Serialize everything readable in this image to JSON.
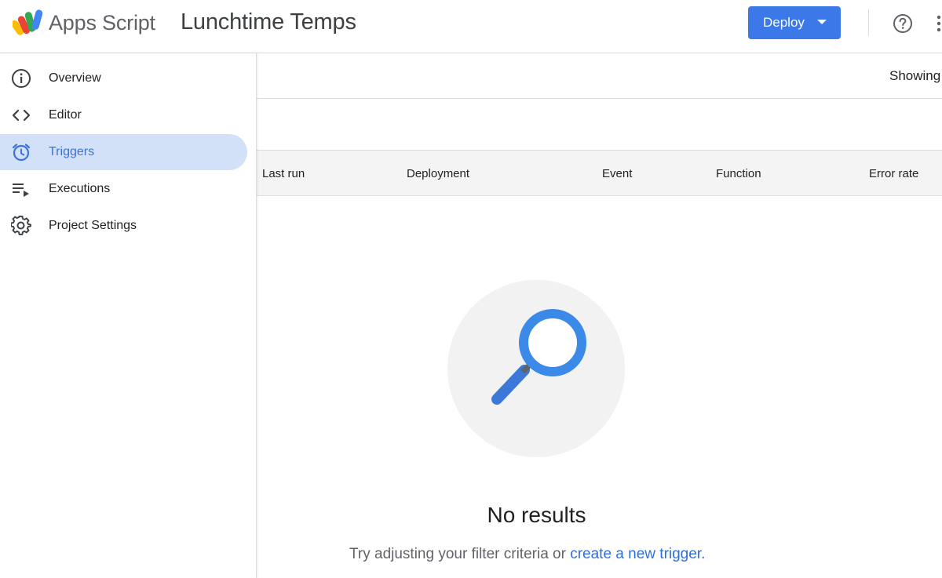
{
  "header": {
    "app_name": "Apps Script",
    "project_title": "Lunchtime Temps",
    "deploy_label": "Deploy",
    "help_icon": "help-circle-icon",
    "more_icon": "more-vert-icon"
  },
  "sidebar": {
    "items": [
      {
        "label": "Overview",
        "icon": "info-icon",
        "active": false
      },
      {
        "label": "Editor",
        "icon": "code-icon",
        "active": false
      },
      {
        "label": "Triggers",
        "icon": "alarm-clock-icon",
        "active": true
      },
      {
        "label": "Executions",
        "icon": "playlist-play-icon",
        "active": false
      },
      {
        "label": "Project Settings",
        "icon": "gear-icon",
        "active": false
      }
    ]
  },
  "main": {
    "showing_label": "Showing",
    "table": {
      "columns": [
        "Last run",
        "Deployment",
        "Event",
        "Function",
        "Error rate"
      ]
    },
    "empty_state": {
      "icon": "search-icon",
      "title": "No results",
      "hint": "Try adjusting your filter criteria or",
      "link": "create a new trigger."
    }
  },
  "colors": {
    "accent": "#1a73e8",
    "active_nav_bg": "#d3e1f8",
    "border": "#dadce0",
    "table_head_bg": "#f4f4f4",
    "empty_circle": "#f2f2f2"
  }
}
